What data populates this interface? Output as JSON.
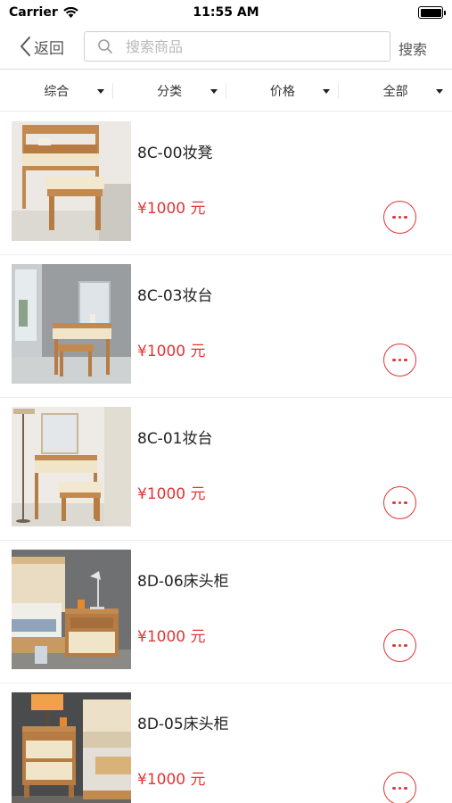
{
  "status_bar": {
    "carrier": "Carrier",
    "time": "11:55 AM"
  },
  "nav": {
    "back_label": "返回",
    "search_placeholder": "搜索商品",
    "search_button": "搜索"
  },
  "filters": [
    {
      "label": "综合"
    },
    {
      "label": "分类"
    },
    {
      "label": "价格"
    },
    {
      "label": "全部"
    }
  ],
  "products": [
    {
      "name": "8C-00妆凳",
      "price": "¥1000 元"
    },
    {
      "name": "8C-03妆台",
      "price": "¥1000 元"
    },
    {
      "name": "8C-01妆台",
      "price": "¥1000 元"
    },
    {
      "name": "8D-06床头柜",
      "price": "¥1000 元"
    },
    {
      "name": "8D-05床头柜",
      "price": "¥1000 元"
    }
  ],
  "colors": {
    "accent": "#e23434",
    "divider": "#ececec"
  },
  "icons": [
    "wifi-icon",
    "battery-icon",
    "back-chevron-icon",
    "search-icon",
    "dropdown-caret-icon",
    "more-icon"
  ]
}
